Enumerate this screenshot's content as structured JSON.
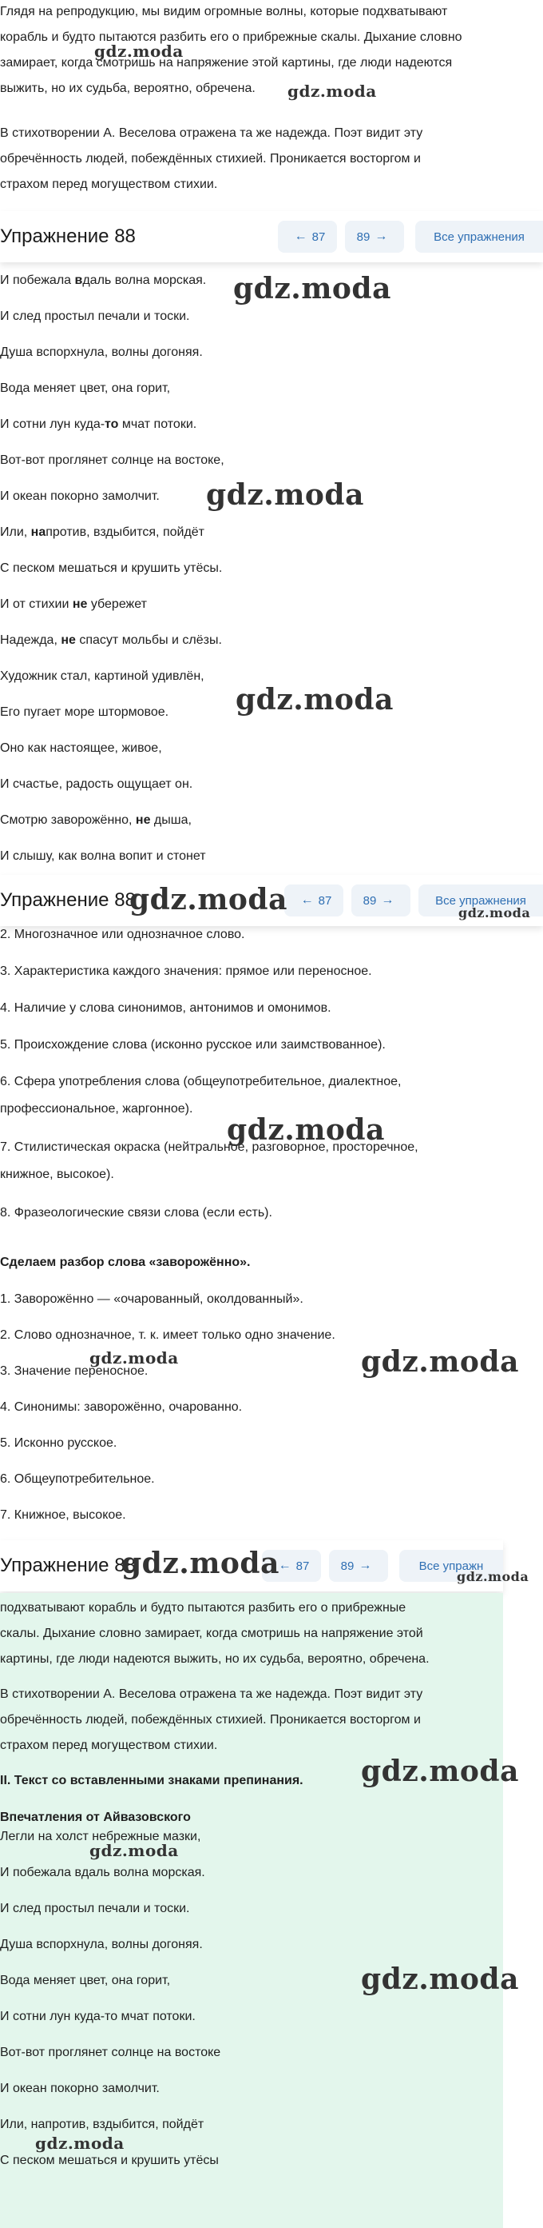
{
  "top_paragraph": [
    "Глядя на репродукцию, мы видим огромные волны, которые подхватывают",
    "корабль и будто пытаются разбить его о прибрежные скалы. Дыхание словно",
    "замирает, когда смотришь на напряжение этой картины, где люди надеются",
    "выжить, но их судьба, вероятно, обречена."
  ],
  "second_paragraph": [
    "В стихотворении А. Веселова отражена та же надежда. Поэт видит эту",
    "обречённость людей, побеждённых стихией. Проникается восторгом и",
    "страхом перед могуществом стихии."
  ],
  "exercise_header": {
    "title": "Упражнение 88",
    "prev_label": "87",
    "next_label": "89",
    "all_label": "Все упражнения",
    "all_label_cut": "Все упражн"
  },
  "watermark": "gdz.moda",
  "poem_block1": [
    {
      "pre": "И побежала ",
      "bold": "в",
      "post": "даль волна морская."
    },
    {
      "pre": "И след простыл печали и тоски.",
      "bold": "",
      "post": ""
    },
    {
      "pre": "Душа вспорхнула, волны догоняя.",
      "bold": "",
      "post": ""
    },
    {
      "pre": "Вода меняет цвет, она горит,",
      "bold": "",
      "post": ""
    },
    {
      "pre": "И сотни лун куда-",
      "bold": "то",
      "post": " мчат потоки."
    },
    {
      "pre": "Вот-вот проглянет солнце на востоке,",
      "bold": "",
      "post": ""
    },
    {
      "pre": "И океан покорно замолчит.",
      "bold": "",
      "post": ""
    },
    {
      "pre": "Или, ",
      "bold": "на",
      "post": "против, вздыбится, пойдёт"
    },
    {
      "pre": "С песком мешаться и крушить утёсы.",
      "bold": "",
      "post": ""
    },
    {
      "pre": "И от стихии ",
      "bold": "не",
      "post": " убережет"
    },
    {
      "pre": "Надежда, ",
      "bold": "не",
      "post": " спасут мольбы и слёзы."
    },
    {
      "pre": "Художник стал, картиной удивлён,",
      "bold": "",
      "post": ""
    },
    {
      "pre": "Его пугает море штормовое.",
      "bold": "",
      "post": ""
    },
    {
      "pre": "Оно как настоящее, живое,",
      "bold": "",
      "post": ""
    },
    {
      "pre": "И счастье, радость ощущает он.",
      "bold": "",
      "post": ""
    },
    {
      "pre": "Смотрю заворожённо, ",
      "bold": "не",
      "post": " дыша,"
    },
    {
      "pre": "И слышу, как волна вопит и стонет",
      "bold": "",
      "post": ""
    }
  ],
  "analysis_plan": [
    "2. Многозначное или однозначное слово.",
    "3. Характеристика каждого значения: прямое или переносное.",
    "4. Наличие у слова синонимов, антонимов и омонимов.",
    "5. Происхождение слова (исконно русское или заимствованное).",
    "6. Сфера употребления слова (общеупотребительное, диалектное,",
    "профессиональное, жаргонное).",
    "7. Стилистическая окраска (нейтральное, разговорное, просторечное,",
    "книжное, высокое).",
    "8. Фразеологические связи слова (если есть)."
  ],
  "analysis_heading": "Сделаем разбор слова «заворожённо».",
  "analysis_items": [
    "1. Заворожённо — «очарованный, околдованный».",
    "2. Слово однозначное, т. к. имеет только одно значение.",
    "3. Значение переносное.",
    "4. Синонимы: заворожённо, очарованно.",
    "5. Исконно русское.",
    "6. Общеупотребительное.",
    "7. Книжное, высокое."
  ],
  "green_paragraph1": [
    "подхватывают корабль и будто пытаются разбить его о прибрежные",
    "скалы. Дыхание словно замирает, когда смотришь на напряжение этой",
    "картины, где люди надеются выжить, но их судьба, вероятно, обречена."
  ],
  "green_paragraph2": [
    "В стихотворении А. Веселова отражена та же надежда. Поэт видит эту",
    "обречённость людей, побеждённых стихией. Проникается восторгом и",
    "страхом перед могуществом стихии."
  ],
  "green_heading": "II. Текст со вставленными знаками препинания.",
  "green_poem_title": "Впечатления от Айвазовского",
  "green_poem": [
    "Легли на холст небрежные мазки,",
    "И побежала вдаль волна морская.",
    "И след простыл печали и тоски.",
    "Душа вспорхнула, волны догоняя.",
    "Вода меняет цвет, она горит,",
    "И сотни лун куда-то мчат потоки.",
    "Вот-вот проглянет солнце на востоке",
    "И океан покорно замолчит.",
    "Или, напротив, вздыбится, пойдёт",
    "С песком мешаться и крушить утёсы"
  ],
  "colors": {
    "link": "#2f6fb3",
    "button_bg": "#eef3f8",
    "green_bg": "#e3f6ec",
    "text": "#1f1f1f"
  },
  "icons": {
    "prev": "arrow-left-icon",
    "next": "arrow-right-icon"
  }
}
